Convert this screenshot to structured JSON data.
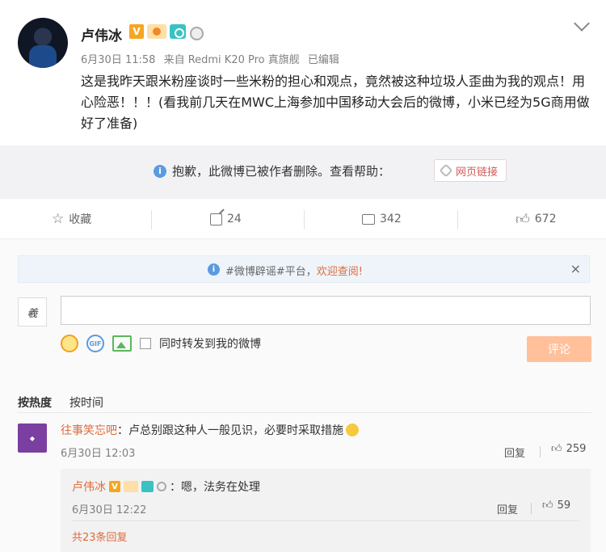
{
  "post": {
    "author": "卢伟冰",
    "badge_v": "V",
    "meta": {
      "date": "6月30日 11:58",
      "source": "来自 Redmi K20 Pro 真旗舰",
      "edited": "已编辑"
    },
    "content": "这是我昨天跟米粉座谈时一些米粉的担心和观点，竟然被这种垃圾人歪曲为我的观点！用心险恶！！！(看我前几天在MWC上海参加中国移动大会后的微博，小米已经为5G商用做好了准备)",
    "icons": [
      "v-badge",
      "anniversary-badge",
      "camera-badge",
      "medal-badge",
      "chevron-down-icon"
    ]
  },
  "deleted_notice": {
    "message": "抱歉，此微博已被作者删除。查看帮助：",
    "link_label": "网页链接"
  },
  "actions": {
    "favorite": "收藏",
    "share_count": "24",
    "comment_count": "342",
    "like_count": "672"
  },
  "comments": {
    "notice_prefix": "#微博辟谣#平台，",
    "notice_highlight": "欢迎查阅!",
    "close_label": "×",
    "my_avatar_text": "羲",
    "input_placeholder": "",
    "forward_label": "同时转发到我的微博",
    "submit_label": "评论",
    "gif_label": "GIF",
    "sort_hot": "按热度",
    "sort_time": "按时间",
    "items": [
      {
        "user": "往事笑忘吧",
        "text": "：卢总别跟这种人一般见识，必要时采取措施",
        "time": "6月30日 12:03",
        "reply_label": "回复",
        "likes": "259",
        "replies": [
          {
            "user": "卢伟冰",
            "badge_v": "V",
            "text": "：嗯，法务在处理",
            "time": "6月30日 12:22",
            "reply_label": "回复",
            "likes": "59"
          }
        ],
        "more_replies": "共23条回复"
      }
    ]
  },
  "colors": {
    "accent_orange": "#e06a3c",
    "badge_gold": "#f5a623",
    "info_blue": "#5a9be0",
    "submit_disabled": "#ffc09a"
  }
}
